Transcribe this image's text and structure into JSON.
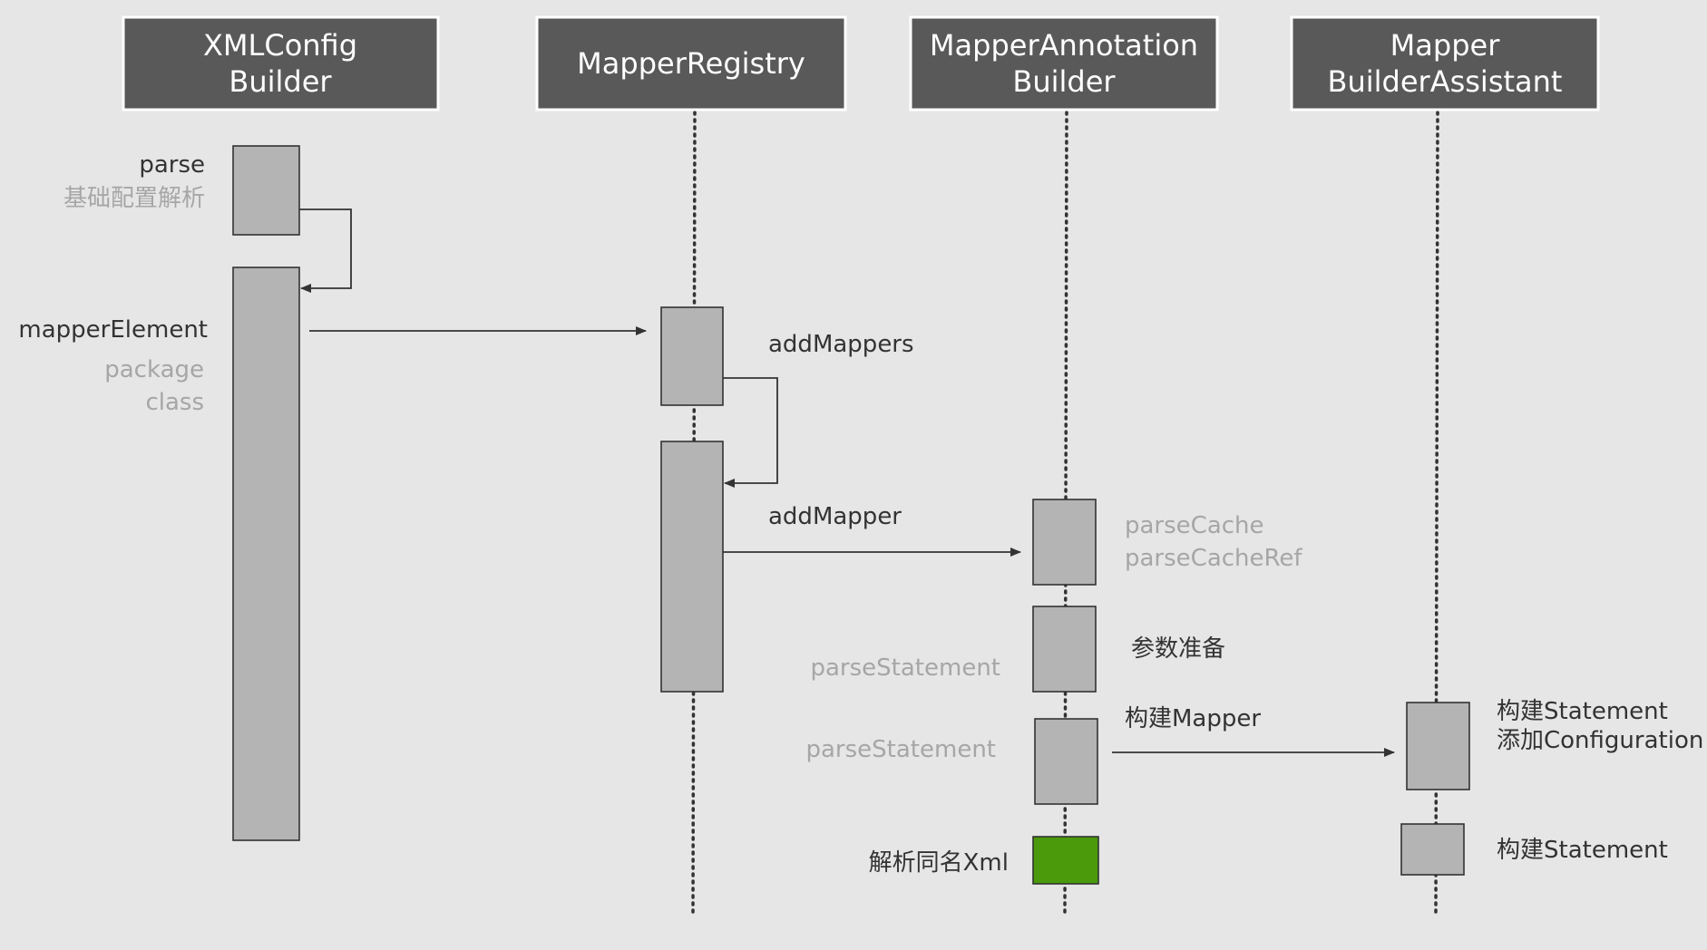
{
  "participants": [
    {
      "id": "xmlconfig",
      "title_lines": [
        "XMLConfig",
        "Builder"
      ]
    },
    {
      "id": "registry",
      "title_lines": [
        "MapperRegistry"
      ]
    },
    {
      "id": "annotation",
      "title_lines": [
        "MapperAnnotation",
        "Builder"
      ]
    },
    {
      "id": "assistant",
      "title_lines": [
        "Mapper",
        "BuilderAssistant"
      ]
    }
  ],
  "labels": {
    "parse": "parse",
    "parse_sub": "基础配置解析",
    "mapper_element": "mapperElement",
    "mapper_element_opt1": "package",
    "mapper_element_opt2": "class",
    "add_mappers": "addMappers",
    "add_mapper": "addMapper",
    "parse_cache": "parseCache",
    "parse_cache_ref": "parseCacheRef",
    "param_prepare": "参数准备",
    "parse_statement_1": "parseStatement",
    "parse_statement_2": "parseStatement",
    "build_mapper": "构建Mapper",
    "build_statement_1": "构建Statement",
    "add_configuration": "添加Configuration",
    "build_statement_2": "构建Statement",
    "parse_same_xml": "解析同名Xml"
  },
  "colors": {
    "background": "#e6e6e6",
    "header_fill": "#595959",
    "header_text": "#ffffff",
    "activation_fill": "#b4b4b4",
    "highlight_activation": "#4a9a0c",
    "line": "#333333",
    "label_dark": "#333333",
    "label_muted": "#a6a6a6"
  }
}
